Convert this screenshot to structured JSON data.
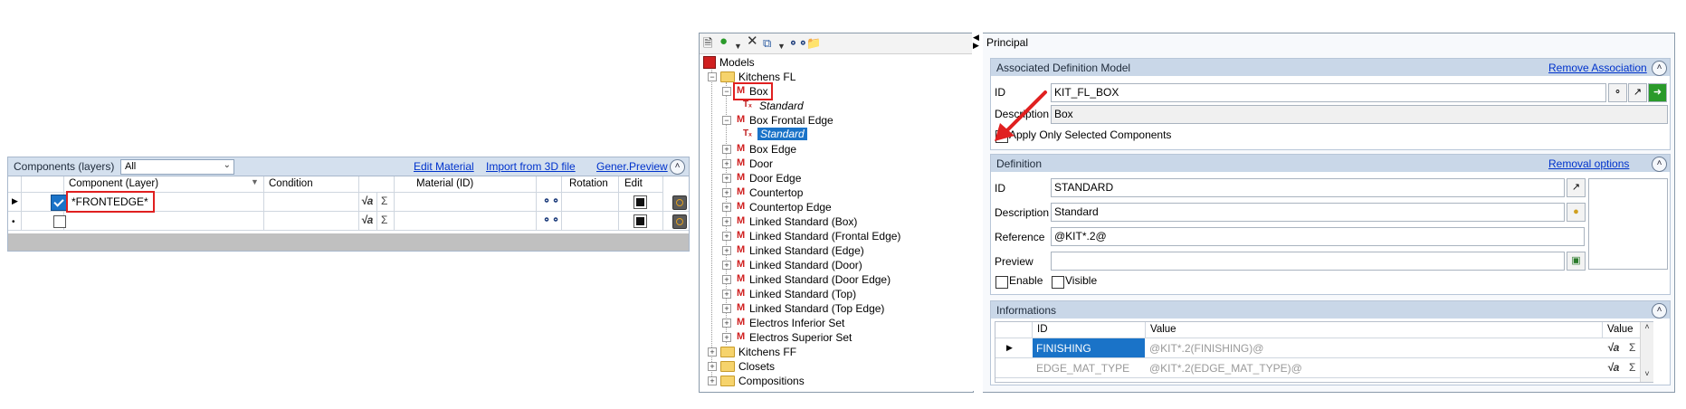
{
  "components_panel": {
    "title": "Components (layers)",
    "filter_value": "All",
    "links": {
      "edit_material": "Edit Material",
      "import_3d": "Import from 3D file",
      "gener_preview": "Gener.Preview"
    },
    "columns": [
      "Component (Layer)",
      "Condition",
      "Material (ID)",
      "Rotation",
      "Edit"
    ],
    "rows": [
      {
        "checked": true,
        "layer": "*FRONTEDGE*",
        "condition": "",
        "material": "",
        "rotation": ""
      },
      {
        "checked": false,
        "layer": "",
        "condition": "",
        "material": "",
        "rotation": ""
      }
    ]
  },
  "tree": {
    "items": [
      {
        "label": "Models",
        "type": "root"
      },
      {
        "label": "Kitchens FL",
        "type": "folder"
      },
      {
        "label": "Box",
        "type": "model"
      },
      {
        "label": "Standard",
        "type": "standard"
      },
      {
        "label": "Box Frontal Edge",
        "type": "model"
      },
      {
        "label": "Standard",
        "type": "standard-selected"
      },
      {
        "label": "Box Edge",
        "type": "model"
      },
      {
        "label": "Door",
        "type": "model"
      },
      {
        "label": "Door Edge",
        "type": "model"
      },
      {
        "label": "Countertop",
        "type": "model"
      },
      {
        "label": "Countertop Edge",
        "type": "model"
      },
      {
        "label": "Linked Standard (Box)",
        "type": "model"
      },
      {
        "label": "Linked Standard (Frontal Edge)",
        "type": "model"
      },
      {
        "label": "Linked Standard (Edge)",
        "type": "model"
      },
      {
        "label": "Linked Standard (Door)",
        "type": "model"
      },
      {
        "label": "Linked Standard (Door Edge)",
        "type": "model"
      },
      {
        "label": "Linked Standard (Top)",
        "type": "model"
      },
      {
        "label": "Linked Standard (Top Edge)",
        "type": "model"
      },
      {
        "label": "Electros Inferior Set",
        "type": "model"
      },
      {
        "label": "Electros Superior Set",
        "type": "model"
      },
      {
        "label": "Kitchens FF",
        "type": "folder"
      },
      {
        "label": "Closets",
        "type": "folder"
      },
      {
        "label": "Compositions",
        "type": "folder"
      }
    ]
  },
  "principal": {
    "title": "Principal",
    "assoc": {
      "title": "Associated Definition Model",
      "link": "Remove Association",
      "id_label": "ID",
      "id_value": "KIT_FL_BOX",
      "desc_label": "Description",
      "desc_value": "Box",
      "apply_only_label": "Apply Only Selected Components",
      "apply_only_checked": true
    },
    "definition": {
      "title": "Definition",
      "link": "Removal options",
      "id_label": "ID",
      "id_value": "STANDARD",
      "desc_label": "Description",
      "desc_value": "Standard",
      "ref_label": "Reference",
      "ref_value": "@KIT*.2@",
      "preview_label": "Preview",
      "preview_value": "",
      "enable_label": "Enable",
      "visible_label": "Visible"
    },
    "informations": {
      "title": "Informations",
      "columns": [
        "ID",
        "Value",
        "Value"
      ],
      "rows": [
        {
          "id": "FINISHING",
          "value": "@KIT*.2(FINISHING)@"
        },
        {
          "id": "EDGE_MAT_TYPE",
          "value": "@KIT*.2(EDGE_MAT_TYPE)@"
        }
      ]
    }
  },
  "colors": {
    "accent_blue": "#1a73c8",
    "annotation_red": "#e02020"
  }
}
